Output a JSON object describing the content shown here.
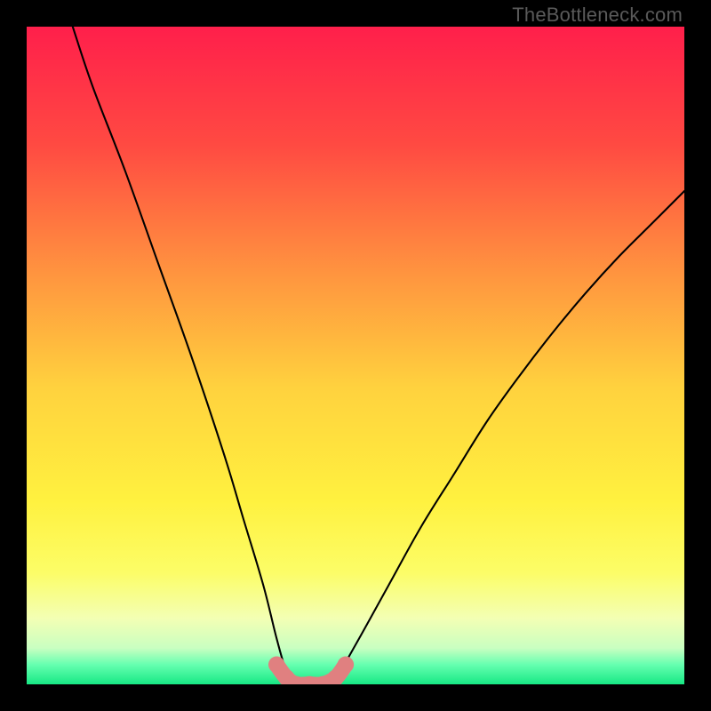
{
  "watermark": "TheBottleneck.com",
  "chart_data": {
    "type": "line",
    "title": "",
    "xlabel": "",
    "ylabel": "",
    "xlim": [
      0,
      100
    ],
    "ylim": [
      0,
      100
    ],
    "grid": false,
    "series": [
      {
        "name": "curve",
        "color": "#000000",
        "x": [
          7,
          10,
          15,
          20,
          25,
          30,
          33,
          36,
          38,
          39.5,
          41,
          43,
          45,
          47,
          50,
          55,
          60,
          65,
          70,
          75,
          80,
          85,
          90,
          95,
          100
        ],
        "y": [
          100,
          91,
          78,
          64,
          50,
          35,
          25,
          15,
          7,
          2,
          0,
          0,
          0,
          1,
          6,
          15,
          24,
          32,
          40,
          47,
          53.5,
          59.5,
          65,
          70,
          75
        ]
      },
      {
        "name": "bottom-markers",
        "color": "#e57373",
        "x": [
          38,
          39.5,
          41,
          43,
          45,
          47,
          48.5
        ],
        "y": [
          3,
          1,
          0,
          0,
          0,
          1,
          3
        ]
      }
    ],
    "gradient_stops": [
      {
        "offset": 0.0,
        "color": "#ff1f4b"
      },
      {
        "offset": 0.18,
        "color": "#ff4a42"
      },
      {
        "offset": 0.38,
        "color": "#ff963f"
      },
      {
        "offset": 0.55,
        "color": "#ffd23e"
      },
      {
        "offset": 0.72,
        "color": "#fff13f"
      },
      {
        "offset": 0.83,
        "color": "#fcfd67"
      },
      {
        "offset": 0.9,
        "color": "#f3ffb4"
      },
      {
        "offset": 0.945,
        "color": "#c9ffc1"
      },
      {
        "offset": 0.97,
        "color": "#66ffb0"
      },
      {
        "offset": 1.0,
        "color": "#17e884"
      }
    ]
  }
}
